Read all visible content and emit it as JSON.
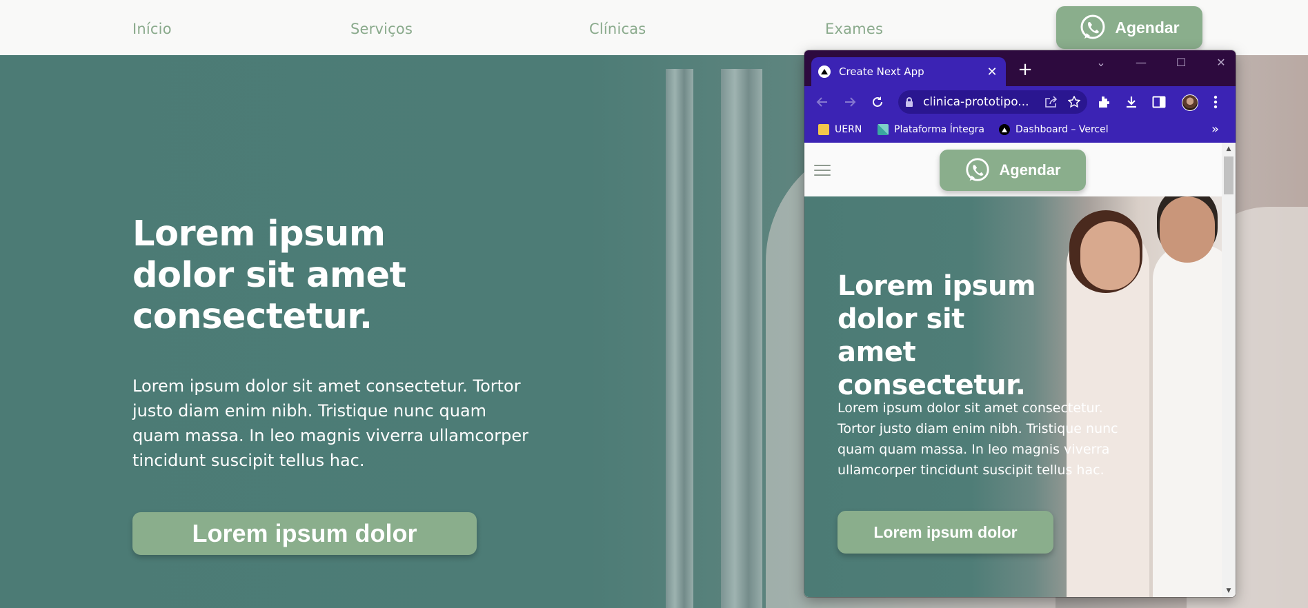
{
  "nav": {
    "links": [
      "Início",
      "Serviços",
      "Clínicas",
      "Exames"
    ],
    "agendar_label": "Agendar"
  },
  "hero": {
    "title": "Lorem ipsum dolor sit amet consectetur.",
    "body": "Lorem ipsum dolor sit amet consectetur. Tortor justo diam enim nibh. Tristique nunc quam quam massa. In leo magnis viverra ullamcorper tincidunt suscipit tellus hac.",
    "cta_label": "Lorem ipsum dolor"
  },
  "browser": {
    "tab_title": "Create Next App",
    "url": "clinica-prototipo...",
    "bookmarks": [
      "UERN",
      "Plataforma Íntegra",
      "Dashboard – Vercel"
    ],
    "bookmarks_more": "»",
    "page": {
      "agendar_label": "Agendar",
      "title": "Lorem ipsum dolor sit amet consectetur.",
      "body": "Lorem ipsum dolor sit amet consectetur. Tortor justo diam enim nibh. Tristique nunc quam quam massa. In leo magnis viverra ullamcorper tincidunt suscipit tellus hac.",
      "cta_label": "Lorem ipsum dolor"
    }
  },
  "colors": {
    "brand_green": "#8aae8c",
    "hero_teal": "#4c7b75",
    "browser_purple": "#3b23b4",
    "tabstrip_dark": "#2d0a3e"
  },
  "icons": [
    "whatsapp-icon",
    "next-logo-icon",
    "back-arrow-icon",
    "forward-arrow-icon",
    "reload-icon",
    "lock-icon",
    "share-icon",
    "star-icon",
    "extensions-icon",
    "download-icon",
    "side-panel-icon",
    "menu-dots-icon",
    "hamburger-icon"
  ]
}
